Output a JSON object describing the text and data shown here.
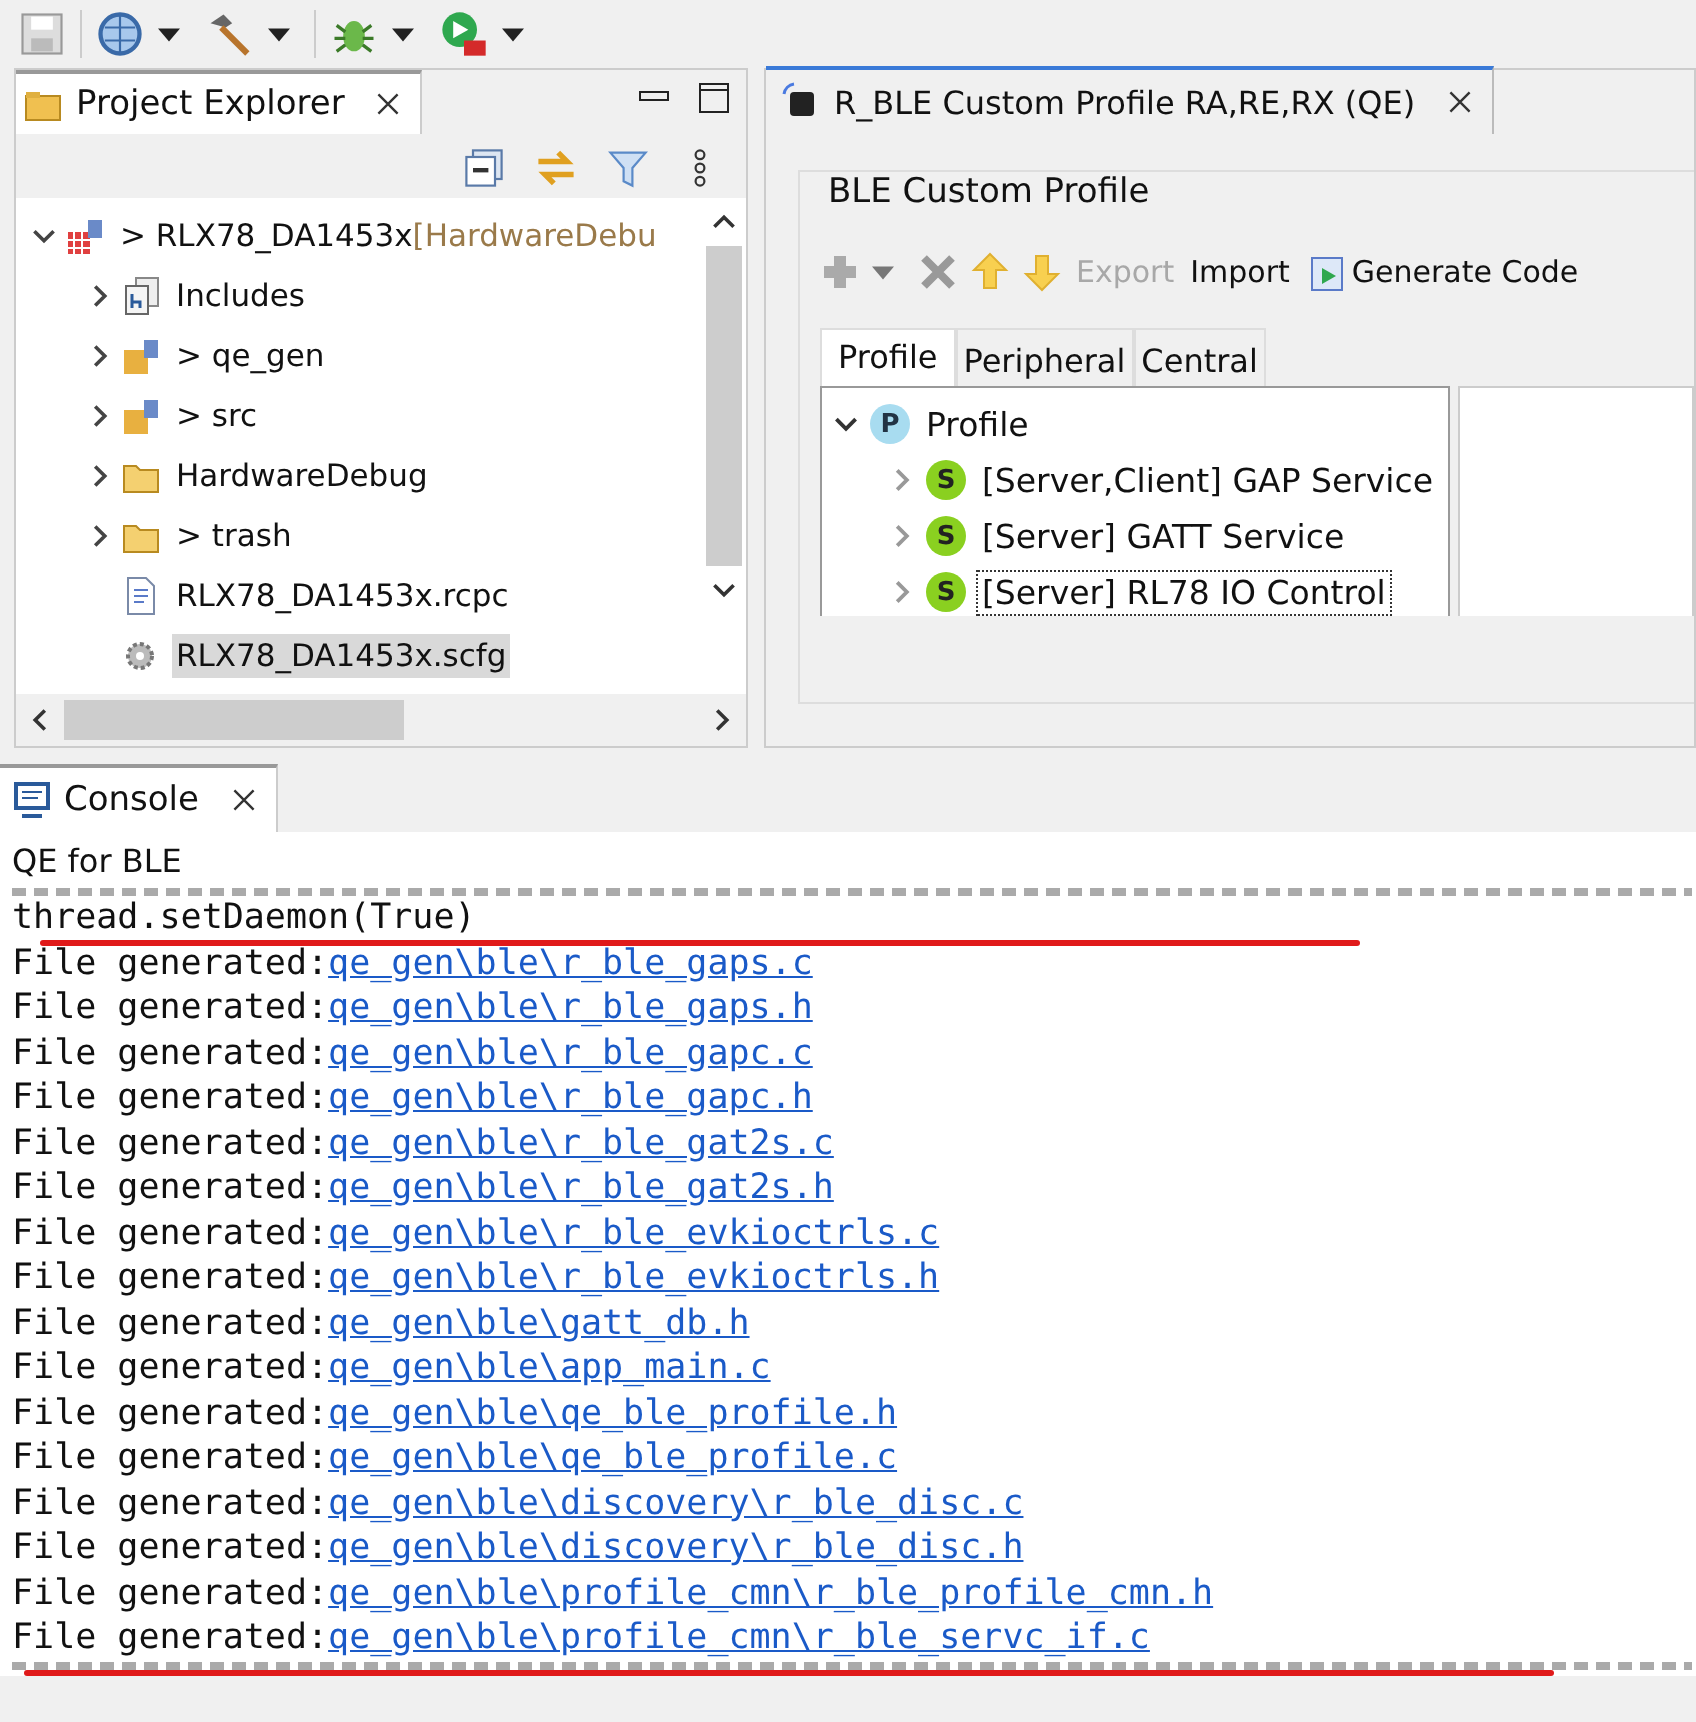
{
  "toolbar": {
    "buttons": [
      {
        "kind": "save"
      },
      {
        "kind": "globe"
      },
      {
        "kind": "hammer"
      },
      {
        "kind": "bug"
      },
      {
        "kind": "run"
      }
    ]
  },
  "project_explorer": {
    "title": "Project Explorer",
    "tree": [
      {
        "label": "> RLX78_DA1453x",
        "suffix": "[HardwareDebu",
        "expanded": true,
        "selected": false,
        "children": [
          {
            "label": "Includes",
            "expanded": false,
            "selected": false
          },
          {
            "label": "> qe_gen",
            "expanded": false,
            "selected": false
          },
          {
            "label": "> src",
            "expanded": false,
            "selected": false
          },
          {
            "label": "HardwareDebug",
            "expanded": false,
            "selected": false
          },
          {
            "label": "> trash",
            "expanded": false,
            "selected": false
          },
          {
            "label": "RLX78_DA1453x.rcpc",
            "selected": false
          },
          {
            "label": "RLX78_DA1453x.scfg",
            "selected": true
          }
        ]
      }
    ]
  },
  "editor": {
    "title": "R_BLE Custom Profile RA,RE,RX (QE)",
    "group_title": "BLE Custom Profile",
    "actions": [
      {
        "kind": "add",
        "disabled": true
      },
      {
        "kind": "delete",
        "disabled": true
      },
      {
        "kind": "up",
        "disabled": false
      },
      {
        "kind": "down",
        "disabled": false
      },
      {
        "kind": "text",
        "label": "Export",
        "disabled": true
      },
      {
        "kind": "text",
        "label": "Import",
        "disabled": false
      },
      {
        "kind": "generate",
        "label": "Generate Code",
        "disabled": false
      }
    ],
    "tabs": [
      {
        "label": "Profile",
        "selected": true
      },
      {
        "label": "Peripheral",
        "selected": false
      },
      {
        "label": "Central",
        "selected": false
      }
    ],
    "tree": [
      {
        "label": "Profile",
        "badge": "P",
        "expanded": true,
        "children": [
          {
            "label": "[Server,Client] GAP Service",
            "badge": "S",
            "expanded": false,
            "focused": false
          },
          {
            "label": "[Server] GATT Service",
            "badge": "S",
            "expanded": false,
            "focused": false
          },
          {
            "label": "[Server] RL78 IO Control",
            "badge": "S",
            "expanded": false,
            "focused": true
          }
        ]
      }
    ]
  },
  "console": {
    "title": "Console",
    "subtitle": "QE for BLE",
    "first_line": "  thread.setDaemon(True)",
    "lines": [
      {
        "prefix": "File generated:",
        "link": "qe_gen\\ble\\r_ble_gaps.c"
      },
      {
        "prefix": "File generated:",
        "link": "qe_gen\\ble\\r_ble_gaps.h"
      },
      {
        "prefix": "File generated:",
        "link": "qe_gen\\ble\\r_ble_gapc.c"
      },
      {
        "prefix": "File generated:",
        "link": "qe_gen\\ble\\r_ble_gapc.h"
      },
      {
        "prefix": "File generated:",
        "link": "qe_gen\\ble\\r_ble_gat2s.c"
      },
      {
        "prefix": "File generated:",
        "link": "qe_gen\\ble\\r_ble_gat2s.h"
      },
      {
        "prefix": "File generated:",
        "link": "qe_gen\\ble\\r_ble_evkioctrls.c"
      },
      {
        "prefix": "File generated:",
        "link": "qe_gen\\ble\\r_ble_evkioctrls.h"
      },
      {
        "prefix": "File generated:",
        "link": "qe_gen\\ble\\gatt_db.h"
      },
      {
        "prefix": "File generated:",
        "link": "qe_gen\\ble\\app_main.c"
      },
      {
        "prefix": "File generated:",
        "link": "qe_gen\\ble\\qe_ble_profile.h"
      },
      {
        "prefix": "File generated:",
        "link": "qe_gen\\ble\\qe_ble_profile.c"
      },
      {
        "prefix": "File generated:",
        "link": "qe_gen\\ble\\discovery\\r_ble_disc.c"
      },
      {
        "prefix": "File generated:",
        "link": "qe_gen\\ble\\discovery\\r_ble_disc.h"
      },
      {
        "prefix": "File generated:",
        "link": "qe_gen\\ble\\profile_cmn\\r_ble_profile_cmn.h"
      },
      {
        "prefix": "File generated:",
        "link": "qe_gen\\ble\\profile_cmn\\r_ble_servc_if.c"
      }
    ]
  }
}
